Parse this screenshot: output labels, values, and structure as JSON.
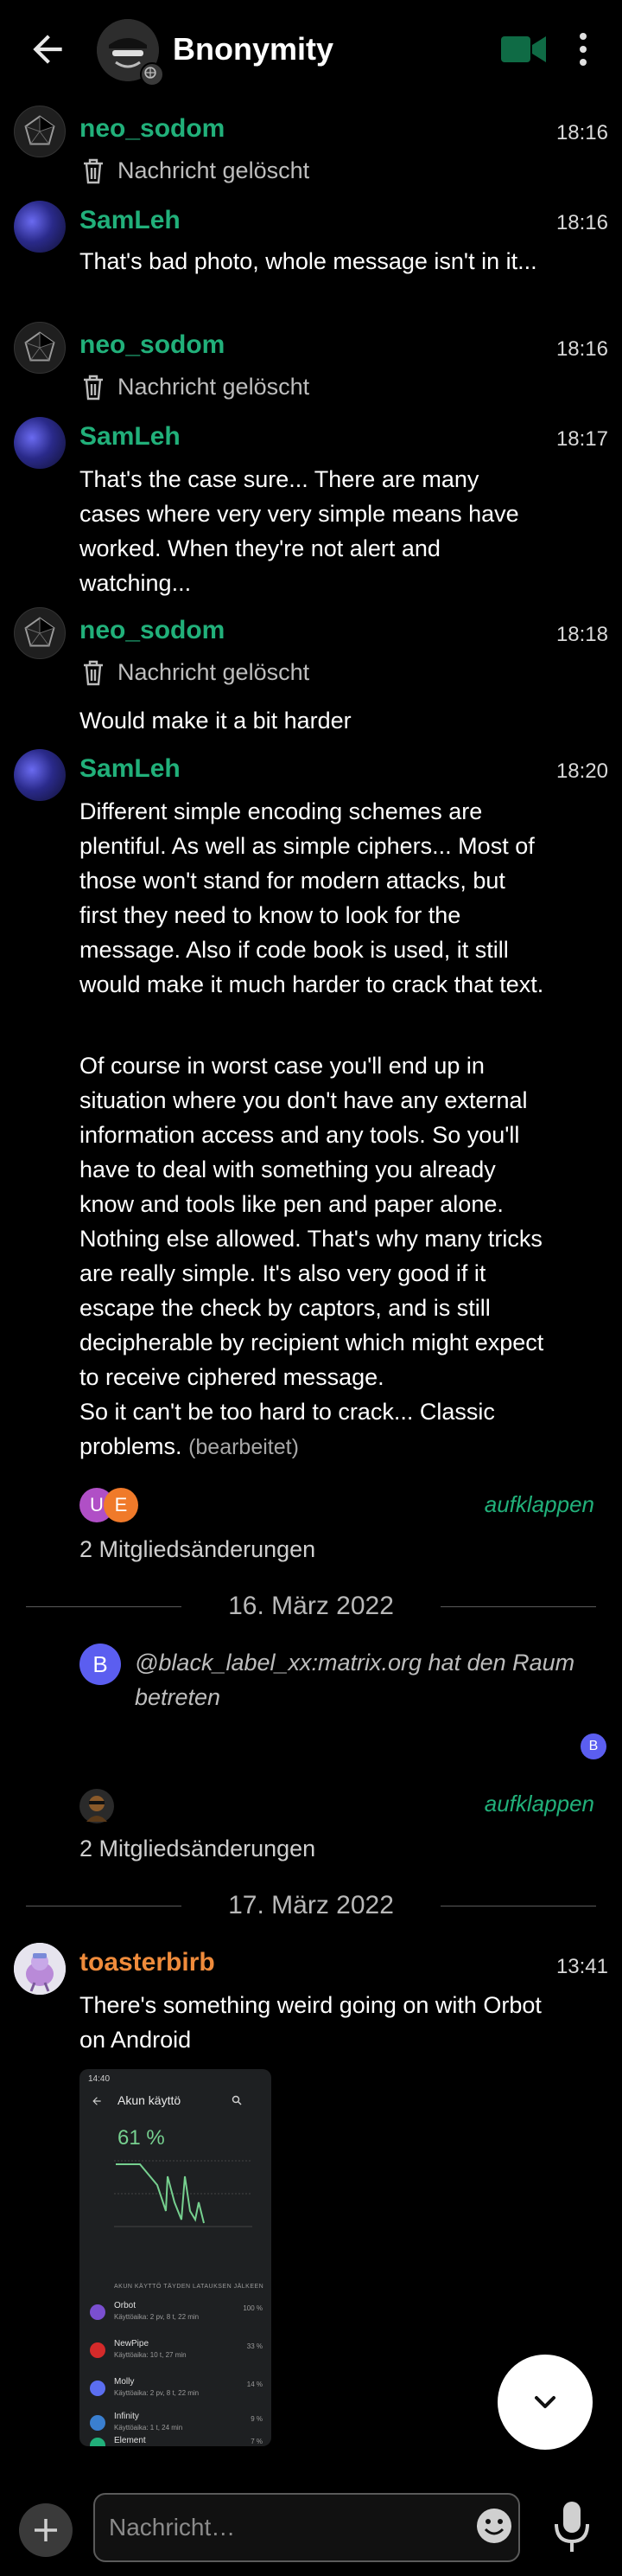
{
  "header": {
    "title": "Bnonymity"
  },
  "messages": [
    {
      "sender": "neo_sodom",
      "time": "18:16",
      "deleted": "Nachricht gelöscht"
    },
    {
      "sender": "SamLeh",
      "time": "18:16",
      "text": "That's bad photo, whole message isn't in it..."
    },
    {
      "sender": "neo_sodom",
      "time": "18:16",
      "deleted": "Nachricht gelöscht"
    },
    {
      "sender": "SamLeh",
      "time": "18:17",
      "text": "That's the case sure... There are many cases where very very simple means have worked. When they're not alert and watching..."
    },
    {
      "sender": "neo_sodom",
      "time": "18:18",
      "deleted": "Nachricht gelöscht",
      "text": "Would make it a bit harder"
    },
    {
      "sender": "SamLeh",
      "time": "18:20",
      "text": "Different simple encoding schemes are plentiful. As well as simple ciphers... Most of those won't stand for modern attacks, but first they need to know to look for the message. Also if code book is used, it still would make it much harder to crack that text.",
      "text2": "Of course in worst case you'll end up in situation where you don't have any external information access and any tools. So you'll have to deal with something you already know and tools like pen and paper alone. Nothing else allowed. That's why many tricks are really simple. It's also very good if it escape the check by captors, and is still decipherable by recipient which might expect to receive ciphered message.",
      "text3": "So it can't be too hard to crack... Classic problems.",
      "edited": "(bearbeitet)"
    }
  ],
  "member_changes_1": {
    "avatars": [
      "U",
      "E"
    ],
    "avatar_colors": [
      "#b04fc6",
      "#f07a2a"
    ],
    "label": "2 Mitgliedsänderungen",
    "expand": "aufklappen"
  },
  "date_1": "16. März 2022",
  "event": {
    "avatar_letter": "B",
    "text": "@black_label_xx:matrix.org hat den Raum betreten",
    "receipt_letter": "B"
  },
  "member_changes_2": {
    "label": "2 Mitgliedsänderungen",
    "expand": "aufklappen"
  },
  "date_2": "17. März 2022",
  "toaster": {
    "sender": "toasterbirb",
    "time": "13:41",
    "text": "There's something weird going on with Orbot on Android",
    "screenshot": {
      "status_time": "14:40",
      "title": "Akun käyttö",
      "percent": "61 %",
      "list_header": "AKUN KÄYTTÖ TÄYDEN LATAUKSEN JÄLKEEN",
      "apps": [
        {
          "name": "Orbot",
          "sub": "Käyttöaika: 2 pv, 8 t, 22 min",
          "value": "100 %",
          "color": "#7a4fd0"
        },
        {
          "name": "NewPipe",
          "sub": "Käyttöaika: 10 t, 27 min",
          "value": "33 %",
          "color": "#d42a2a"
        },
        {
          "name": "Molly",
          "sub": "Käyttöaika: 2 pv, 8 t, 22 min",
          "value": "14 %",
          "color": "#5b6ef0"
        },
        {
          "name": "Infinity",
          "sub": "Käyttöaika: 1 t, 24 min",
          "value": "9 %",
          "color": "#3a7fd0"
        },
        {
          "name": "Element",
          "sub": "",
          "value": "7 %",
          "color": "#21b07a"
        }
      ]
    }
  },
  "composer": {
    "placeholder": "Nachricht…"
  }
}
